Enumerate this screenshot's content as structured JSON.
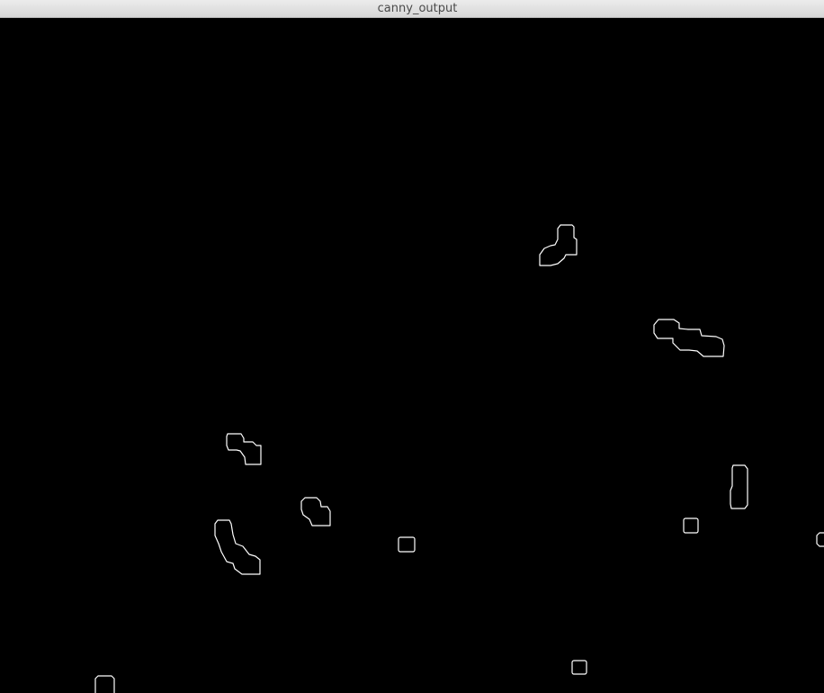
{
  "window": {
    "title": "canny_output"
  },
  "image": {
    "background_color": "#000000",
    "edge_color": "#ffffff",
    "description_kind": "binary edge map (black background, white contours)"
  }
}
